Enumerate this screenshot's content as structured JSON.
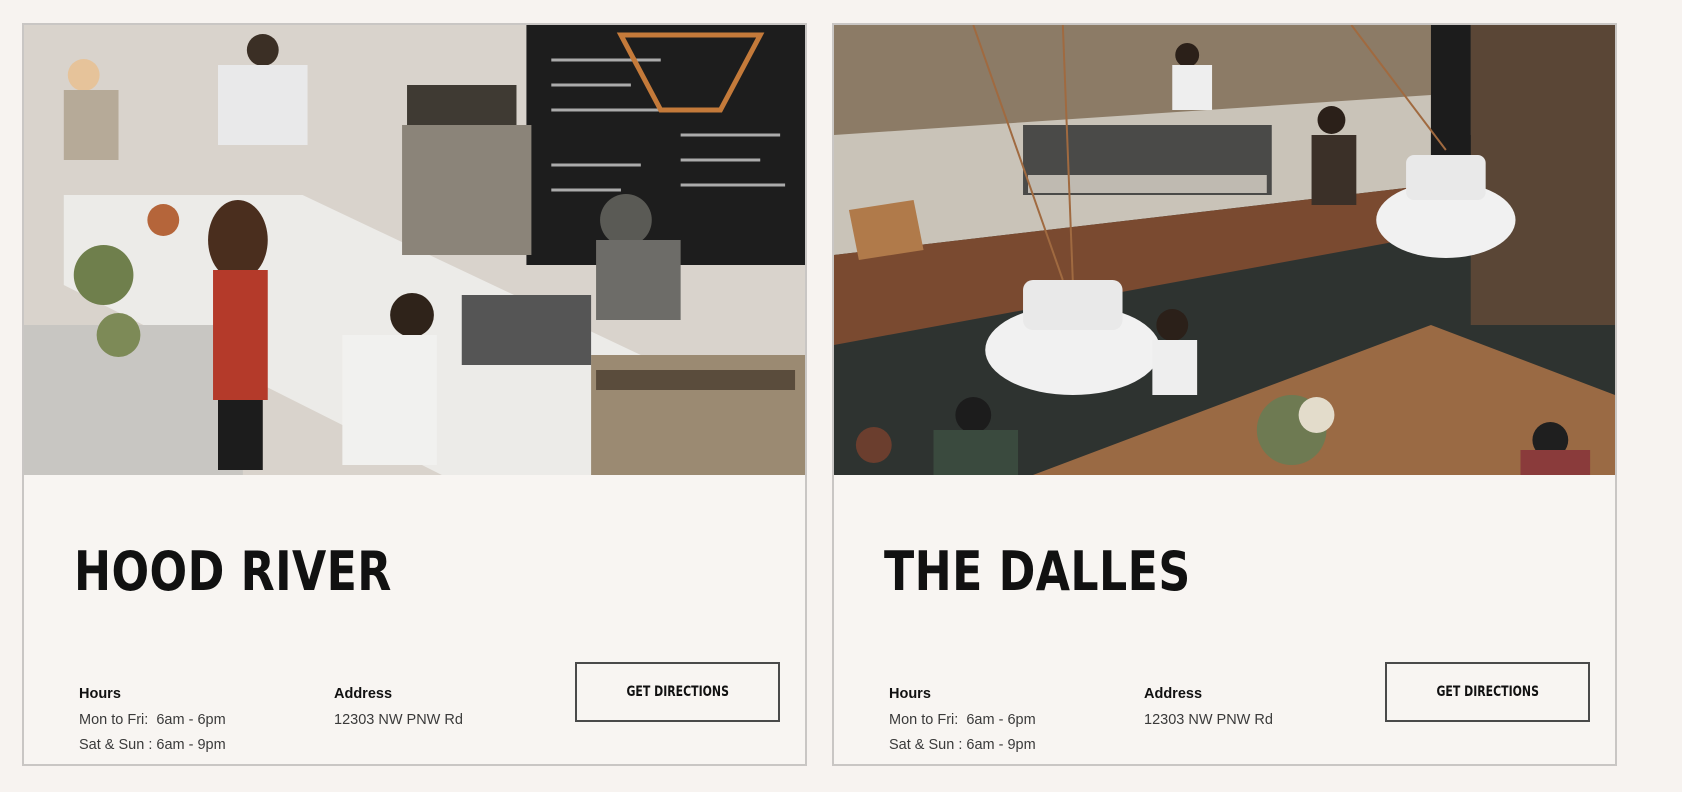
{
  "locations": [
    {
      "name": "HOOD RIVER",
      "hours_label": "Hours",
      "hours_weekday": "Mon to Fri:  6am - 6pm",
      "hours_weekend": "Sat & Sun : 6am - 9pm",
      "address_label": "Address",
      "address": "12303 NW PNW Rd",
      "button_label": "GET DIRECTIONS"
    },
    {
      "name": "THE DALLES",
      "hours_label": "Hours",
      "hours_weekday": "Mon to Fri:  6am - 6pm",
      "hours_weekend": "Sat & Sun : 6am - 9pm",
      "address_label": "Address",
      "address": "12303 NW PNW Rd",
      "button_label": "GET DIRECTIONS"
    }
  ],
  "colors": {
    "page_background": "#f7f3f0",
    "card_background": "#f8f5f2",
    "card_border": "#c9c6c4",
    "text": "#111111"
  }
}
